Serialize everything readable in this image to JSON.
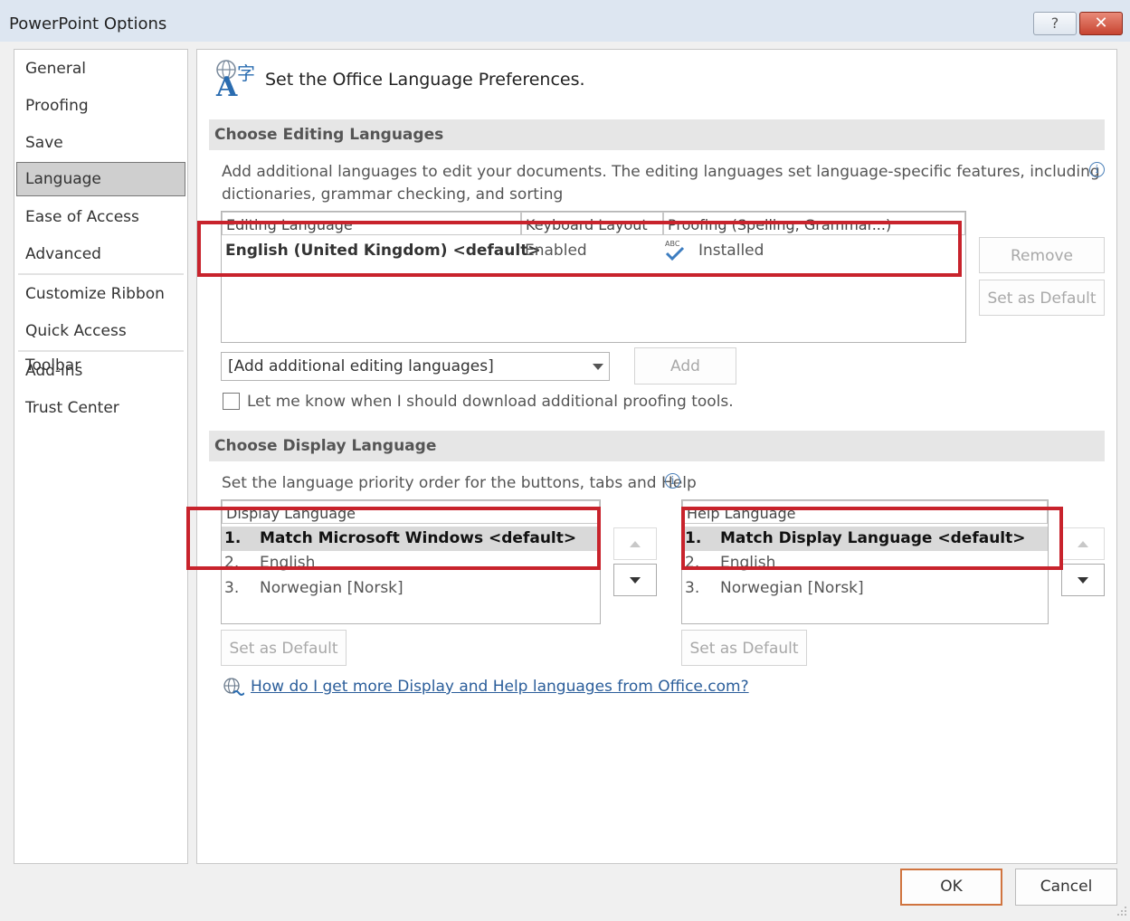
{
  "window": {
    "title": "PowerPoint Options",
    "help_glyph": "?",
    "close_glyph": "✕"
  },
  "sidebar": {
    "items": [
      {
        "label": "General"
      },
      {
        "label": "Proofing"
      },
      {
        "label": "Save"
      },
      {
        "label": "Language"
      },
      {
        "label": "Ease of Access"
      },
      {
        "label": "Advanced"
      },
      {
        "label": "Customize Ribbon"
      },
      {
        "label": "Quick Access Toolbar"
      },
      {
        "label": "Add-ins"
      },
      {
        "label": "Trust Center"
      }
    ],
    "active": "Language"
  },
  "header": {
    "title": "Set the Office Language Preferences.",
    "icon": "language-icon"
  },
  "editing": {
    "section_title": "Choose Editing Languages",
    "description_line1": "Add additional languages to edit your documents. The editing languages set language-specific features, including",
    "description_line2": "dictionaries, grammar checking, and sorting",
    "columns": [
      "Editing Language",
      "Keyboard Layout",
      "Proofing (Spelling, Grammar...)"
    ],
    "rows": [
      {
        "language": "English (United Kingdom) <default>",
        "keyboard": "Enabled",
        "proofing": "Installed",
        "proofing_icon_text": "ABC"
      }
    ],
    "remove_label": "Remove",
    "set_default_label": "Set as Default",
    "add_combo_value": "[Add additional editing languages]",
    "add_label": "Add",
    "checkbox_label": "Let me know when I should download additional proofing tools.",
    "checkbox_checked": false
  },
  "display": {
    "section_title": "Choose Display Language",
    "description": "Set the language priority order for the buttons, tabs and Help",
    "display_list": {
      "header": "Display Language",
      "items": [
        {
          "num": "1.",
          "name": "Match Microsoft Windows <default>"
        },
        {
          "num": "2.",
          "name": "English"
        },
        {
          "num": "3.",
          "name": "Norwegian [Norsk]"
        }
      ],
      "selected_index": 0
    },
    "help_list": {
      "header": "Help Language",
      "items": [
        {
          "num": "1.",
          "name": "Match Display Language <default>"
        },
        {
          "num": "2.",
          "name": "English"
        },
        {
          "num": "3.",
          "name": "Norwegian [Norsk]"
        }
      ],
      "selected_index": 0
    },
    "set_default_label": "Set as Default",
    "link_text": "How do I get more Display and Help languages from Office.com?"
  },
  "footer": {
    "ok_label": "OK",
    "cancel_label": "Cancel"
  },
  "colors": {
    "highlight_box": "#c8232c",
    "link": "#2a5d9a",
    "ok_border": "#d0743f"
  }
}
